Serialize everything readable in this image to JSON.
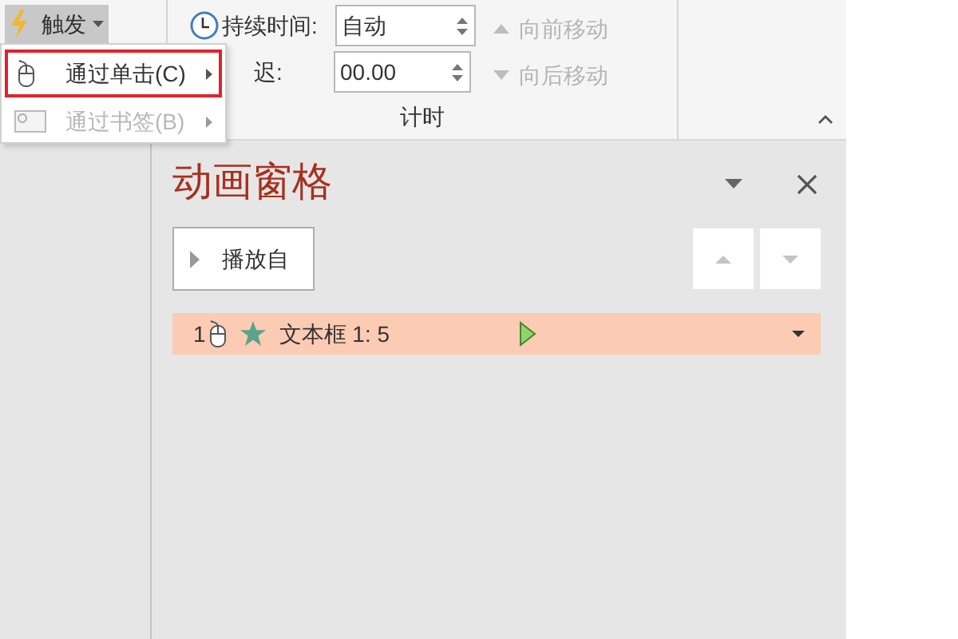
{
  "ribbon": {
    "trigger_button": {
      "label": "触发"
    },
    "timing_group": {
      "title": "计时",
      "fields": [
        {
          "kind": "duration",
          "label": "持续时间:",
          "value": "自动"
        },
        {
          "kind": "delay",
          "label": "迟:",
          "value": "00.00"
        }
      ],
      "move_buttons": [
        {
          "kind": "up",
          "label": "向前移动",
          "disabled": true
        },
        {
          "kind": "down",
          "label": "向后移动",
          "disabled": true
        }
      ]
    }
  },
  "trigger_menu": {
    "items": [
      {
        "kind": "click",
        "label": "通过单击(C)",
        "selected": true,
        "disabled": false
      },
      {
        "kind": "bookmark",
        "label": "通过书签(B)",
        "selected": false,
        "disabled": true
      }
    ]
  },
  "animation_pane": {
    "title": "动画窗格",
    "play_button": {
      "label": "播放自"
    },
    "items": [
      {
        "number": "1",
        "name": "文本框 1: 5",
        "selected": true
      }
    ]
  }
}
